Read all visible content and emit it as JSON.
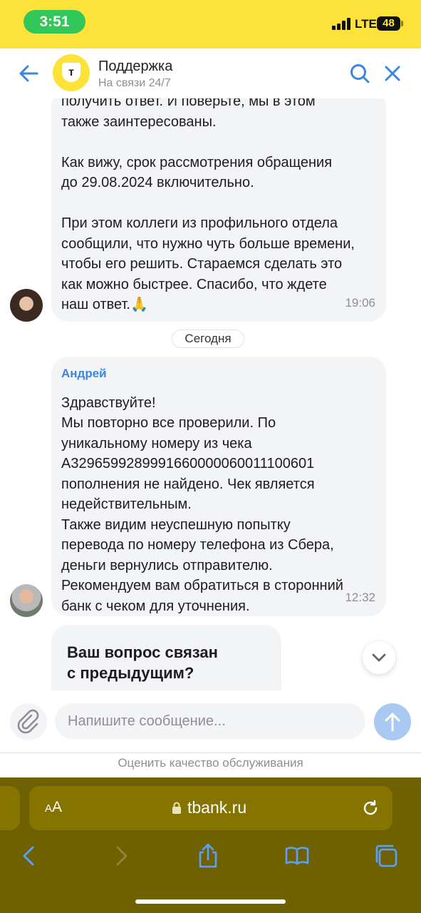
{
  "status_bar": {
    "time": "3:51",
    "network": "LTE",
    "battery": "48"
  },
  "header": {
    "title": "Поддержка",
    "subtitle": "На связи 24/7",
    "logo_letter": "т"
  },
  "messages": [
    {
      "text": "получить ответ. И поверьте, мы в этом\nтакже заинтересованы.\n\nКак вижу, срок рассмотрения обращения\nдо 29.08.2024 включительно.\n\nПри этом коллеги из профильного отдела\nсообщили, что нужно чуть больше времени,\nчтобы его решить. Стараемся сделать это\nкак можно быстрее. Спасибо, что ждете\nнаш ответ.🙏",
      "time": "19:06"
    },
    {
      "author": "Андрей",
      "text": "Здравствуйте!\nМы повторно все проверили. По\nуникальному номеру из чека\nA3296599289991660000060011100601\nпополнения не найдено. Чек является\nнедействительным.\nТакже видим неуспешную попытку\nперевода по номеру телефона из Сбера,\nденьги вернулись отправителю.\nРекомендуем вам обратиться в сторонний\nбанк с чеком для уточнения.",
      "time": "12:32"
    }
  ],
  "date_separator": "Сегодня",
  "question": "Ваш вопрос связан\nс предыдущим?",
  "input": {
    "placeholder": "Напишите сообщение..."
  },
  "rate_link": "Оценить качество обслуживания",
  "browser": {
    "text_size_label_small": "A",
    "text_size_label_big": "A",
    "url": "tbank.ru"
  },
  "colors": {
    "brand_yellow": "#fde23a",
    "link_blue": "#3d86e0",
    "bubble_bg": "#f3f4f6",
    "browser_bar": "#6f6100"
  },
  "icons": [
    "back-arrow-icon",
    "search-icon",
    "close-icon",
    "chevron-down-icon",
    "paperclip-icon",
    "send-arrow-icon",
    "lock-icon",
    "reload-icon",
    "browser-back-icon",
    "browser-forward-icon",
    "share-icon",
    "bookmarks-icon",
    "tabs-icon"
  ]
}
